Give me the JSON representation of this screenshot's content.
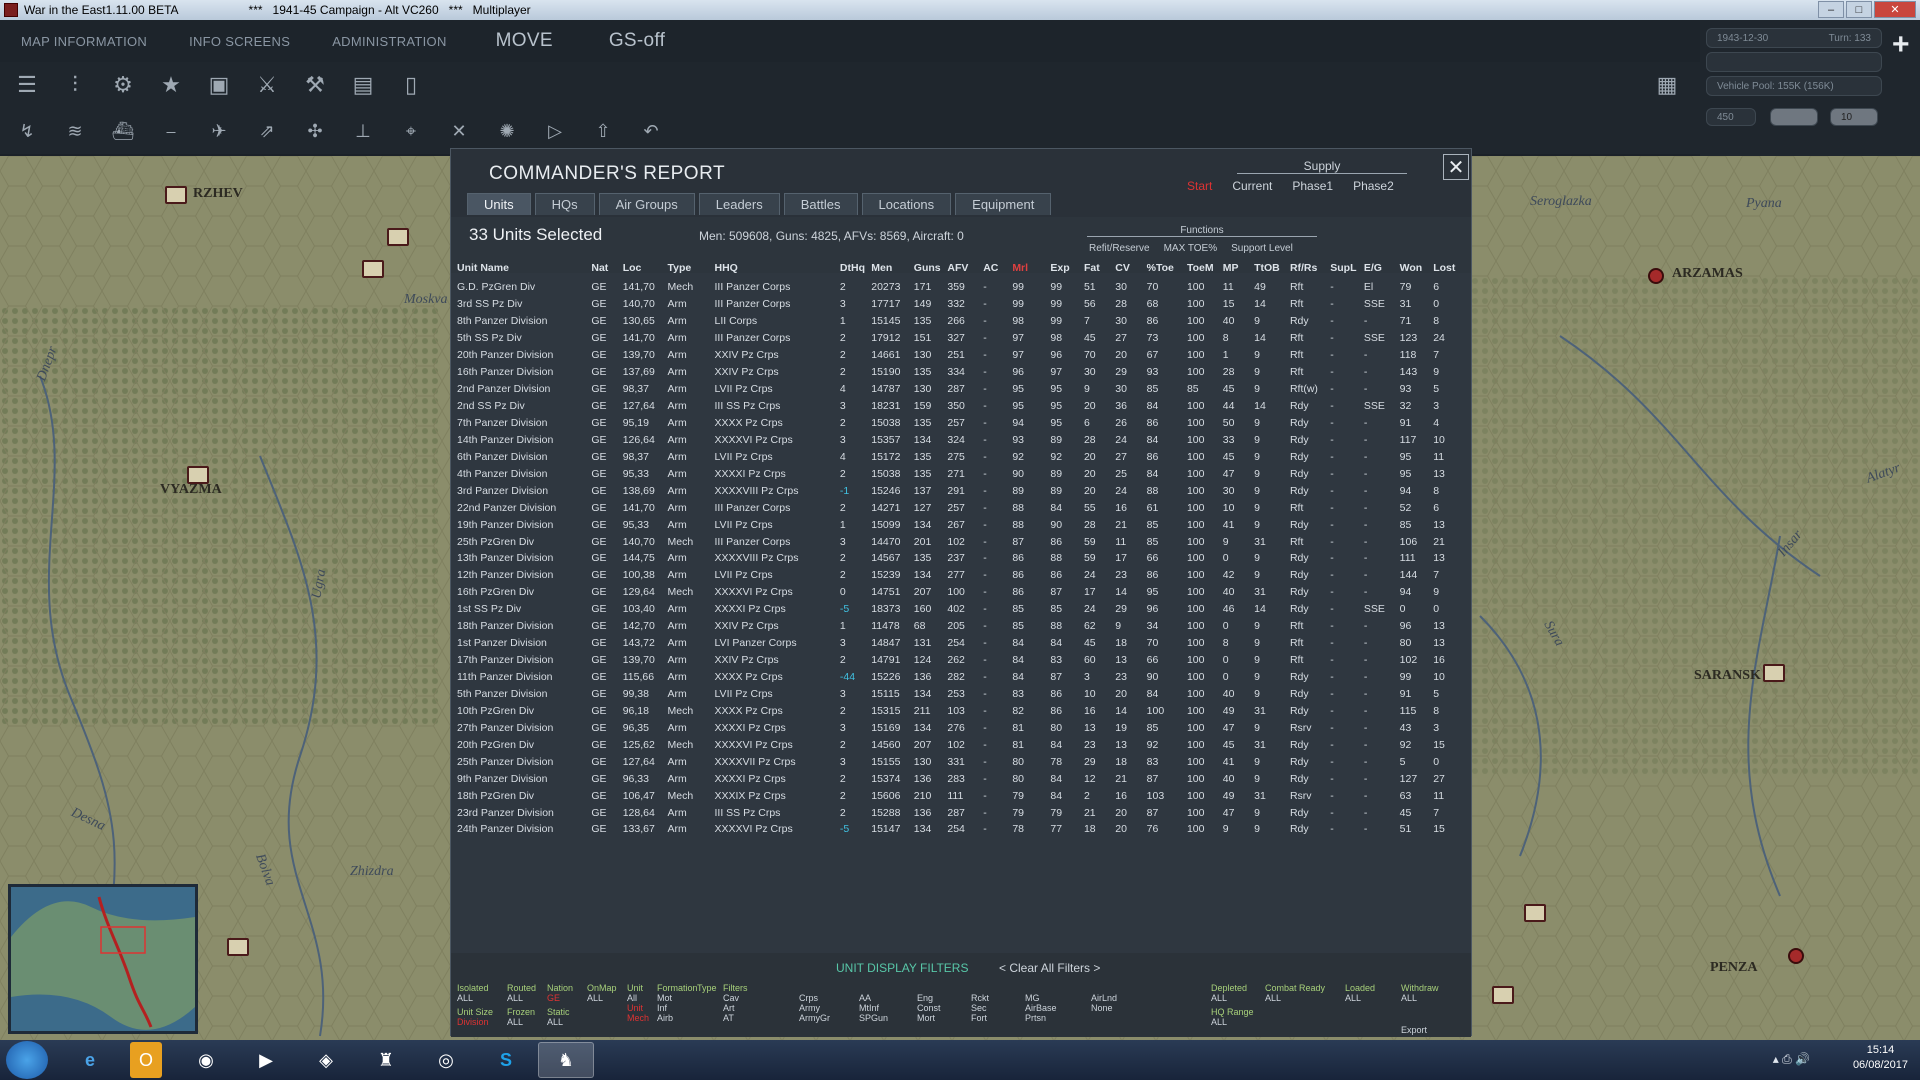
{
  "window": {
    "title": "War in the East1.11.00 BETA",
    "subtitle": "***   1941-45 Campaign - Alt VC260   ***   Multiplayer"
  },
  "topmenu": {
    "map_information": "MAP INFORMATION",
    "info_screens": "INFO SCREENS",
    "administration": "ADMINISTRATION",
    "move": "MOVE",
    "gs_off": "GS-off"
  },
  "right_info": {
    "date": "1943-12-30",
    "turn": "Turn: 133",
    "vehicle_pool": "Vehicle Pool: 155K (156K)",
    "value": "450",
    "counter": "10"
  },
  "map": {
    "cities": [
      "RZHEV",
      "VYAZMA",
      "ARZAMAS",
      "SARANSK",
      "PENZA"
    ],
    "rivers": [
      "Desna",
      "Ugra",
      "Zhizdra",
      "Bolva",
      "Moskva",
      "Dnepr",
      "Alatyr",
      "Pyana",
      "Sura",
      "Insar",
      "Seroglazka"
    ]
  },
  "dialog": {
    "title": "COMMANDER'S REPORT",
    "supply": {
      "label": "Supply",
      "options": [
        "Start",
        "Current",
        "Phase1",
        "Phase2"
      ]
    },
    "tabs": [
      "Units",
      "HQs",
      "Air Groups",
      "Leaders",
      "Battles",
      "Locations",
      "Equipment"
    ],
    "selected": "33 Units Selected",
    "stats": "Men: 509608, Guns: 4825, AFVs: 8569, Aircraft: 0",
    "functions": {
      "label": "Functions",
      "options": [
        "Refit/Reserve",
        "MAX TOE%",
        "Support Level"
      ]
    },
    "columns": [
      "Unit Name",
      "Nat",
      "Loc",
      "Type",
      "HHQ",
      "DtHq",
      "Men",
      "Guns",
      "AFV",
      "AC",
      "Mrl",
      "Exp",
      "Fat",
      "CV",
      "%Toe",
      "ToeM",
      "MP",
      "TtOB",
      "Rf/Rs",
      "SupL",
      "E/G",
      "Won",
      "Lost"
    ],
    "rows": [
      [
        "G.D. PzGren Div",
        "GE",
        "141,70",
        "Mech",
        "III Panzer Corps",
        "2",
        "20273",
        "171",
        "359",
        "-",
        "99",
        "99",
        "51",
        "30",
        "70",
        "100",
        "11",
        "49",
        "Rft",
        "-",
        "El",
        "79",
        "6"
      ],
      [
        "3rd SS Pz Div",
        "GE",
        "140,70",
        "Arm",
        "III Panzer Corps",
        "3",
        "17717",
        "149",
        "332",
        "-",
        "99",
        "99",
        "56",
        "28",
        "68",
        "100",
        "15",
        "14",
        "Rft",
        "-",
        "SSE",
        "31",
        "0"
      ],
      [
        "8th Panzer Division",
        "GE",
        "130,65",
        "Arm",
        "LII Corps",
        "1",
        "15145",
        "135",
        "266",
        "-",
        "98",
        "99",
        "7",
        "30",
        "86",
        "100",
        "40",
        "9",
        "Rdy",
        "-",
        "-",
        "71",
        "8"
      ],
      [
        "5th SS Pz Div",
        "GE",
        "141,70",
        "Arm",
        "III Panzer Corps",
        "2",
        "17912",
        "151",
        "327",
        "-",
        "97",
        "98",
        "45",
        "27",
        "73",
        "100",
        "8",
        "14",
        "Rft",
        "-",
        "SSE",
        "123",
        "24"
      ],
      [
        "20th Panzer Division",
        "GE",
        "139,70",
        "Arm",
        "XXIV Pz Crps",
        "2",
        "14661",
        "130",
        "251",
        "-",
        "97",
        "96",
        "70",
        "20",
        "67",
        "100",
        "1",
        "9",
        "Rft",
        "-",
        "-",
        "118",
        "7"
      ],
      [
        "16th Panzer Division",
        "GE",
        "137,69",
        "Arm",
        "XXIV Pz Crps",
        "2",
        "15190",
        "135",
        "334",
        "-",
        "96",
        "97",
        "30",
        "29",
        "93",
        "100",
        "28",
        "9",
        "Rft",
        "-",
        "-",
        "143",
        "9"
      ],
      [
        "2nd Panzer Division",
        "GE",
        "98,37",
        "Arm",
        "LVII Pz Crps",
        "4",
        "14787",
        "130",
        "287",
        "-",
        "95",
        "95",
        "9",
        "30",
        "85",
        "85",
        "45",
        "9",
        "Rft(w)",
        "-",
        "-",
        "93",
        "5"
      ],
      [
        "2nd SS Pz Div",
        "GE",
        "127,64",
        "Arm",
        "III SS Pz Crps",
        "3",
        "18231",
        "159",
        "350",
        "-",
        "95",
        "95",
        "20",
        "36",
        "84",
        "100",
        "44",
        "14",
        "Rdy",
        "-",
        "SSE",
        "32",
        "3"
      ],
      [
        "7th Panzer Division",
        "GE",
        "95,19",
        "Arm",
        "XXXX Pz Crps",
        "2",
        "15038",
        "135",
        "257",
        "-",
        "94",
        "95",
        "6",
        "26",
        "86",
        "100",
        "50",
        "9",
        "Rdy",
        "-",
        "-",
        "91",
        "4"
      ],
      [
        "14th Panzer Division",
        "GE",
        "126,64",
        "Arm",
        "XXXXVI Pz Crps",
        "3",
        "15357",
        "134",
        "324",
        "-",
        "93",
        "89",
        "28",
        "24",
        "84",
        "100",
        "33",
        "9",
        "Rdy",
        "-",
        "-",
        "117",
        "10"
      ],
      [
        "6th Panzer Division",
        "GE",
        "98,37",
        "Arm",
        "LVII Pz Crps",
        "4",
        "15172",
        "135",
        "275",
        "-",
        "92",
        "92",
        "20",
        "27",
        "86",
        "100",
        "45",
        "9",
        "Rdy",
        "-",
        "-",
        "95",
        "11"
      ],
      [
        "4th Panzer Division",
        "GE",
        "95,33",
        "Arm",
        "XXXXI Pz Crps",
        "2",
        "15038",
        "135",
        "271",
        "-",
        "90",
        "89",
        "20",
        "25",
        "84",
        "100",
        "47",
        "9",
        "Rdy",
        "-",
        "-",
        "95",
        "13"
      ],
      [
        "3rd Panzer Division",
        "GE",
        "138,69",
        "Arm",
        "XXXXVIII Pz Crps",
        "-1",
        "15246",
        "137",
        "291",
        "-",
        "89",
        "89",
        "20",
        "24",
        "88",
        "100",
        "30",
        "9",
        "Rdy",
        "-",
        "-",
        "94",
        "8"
      ],
      [
        "22nd Panzer Division",
        "GE",
        "141,70",
        "Arm",
        "III Panzer Corps",
        "2",
        "14271",
        "127",
        "257",
        "-",
        "88",
        "84",
        "55",
        "16",
        "61",
        "100",
        "10",
        "9",
        "Rft",
        "-",
        "-",
        "52",
        "6"
      ],
      [
        "19th Panzer Division",
        "GE",
        "95,33",
        "Arm",
        "LVII Pz Crps",
        "1",
        "15099",
        "134",
        "267",
        "-",
        "88",
        "90",
        "28",
        "21",
        "85",
        "100",
        "41",
        "9",
        "Rdy",
        "-",
        "-",
        "85",
        "13"
      ],
      [
        "25th PzGren Div",
        "GE",
        "140,70",
        "Mech",
        "III Panzer Corps",
        "3",
        "14470",
        "201",
        "102",
        "-",
        "87",
        "86",
        "59",
        "11",
        "85",
        "100",
        "9",
        "31",
        "Rft",
        "-",
        "-",
        "106",
        "21"
      ],
      [
        "13th Panzer Division",
        "GE",
        "144,75",
        "Arm",
        "XXXXVIII Pz Crps",
        "2",
        "14567",
        "135",
        "237",
        "-",
        "86",
        "88",
        "59",
        "17",
        "66",
        "100",
        "0",
        "9",
        "Rdy",
        "-",
        "-",
        "111",
        "13"
      ],
      [
        "12th Panzer Division",
        "GE",
        "100,38",
        "Arm",
        "LVII Pz Crps",
        "2",
        "15239",
        "134",
        "277",
        "-",
        "86",
        "86",
        "24",
        "23",
        "86",
        "100",
        "42",
        "9",
        "Rdy",
        "-",
        "-",
        "144",
        "7"
      ],
      [
        "16th PzGren Div",
        "GE",
        "129,64",
        "Mech",
        "XXXXVI Pz Crps",
        "0",
        "14751",
        "207",
        "100",
        "-",
        "86",
        "87",
        "17",
        "14",
        "95",
        "100",
        "40",
        "31",
        "Rdy",
        "-",
        "-",
        "94",
        "9"
      ],
      [
        "1st SS Pz Div",
        "GE",
        "103,40",
        "Arm",
        "XXXXI Pz Crps",
        "-5",
        "18373",
        "160",
        "402",
        "-",
        "85",
        "85",
        "24",
        "29",
        "96",
        "100",
        "46",
        "14",
        "Rdy",
        "-",
        "SSE",
        "0",
        "0"
      ],
      [
        "18th Panzer Division",
        "GE",
        "142,70",
        "Arm",
        "XXIV Pz Crps",
        "1",
        "11478",
        "68",
        "205",
        "-",
        "85",
        "88",
        "62",
        "9",
        "34",
        "100",
        "0",
        "9",
        "Rft",
        "-",
        "-",
        "96",
        "13"
      ],
      [
        "1st Panzer Division",
        "GE",
        "143,72",
        "Arm",
        "LVI Panzer Corps",
        "3",
        "14847",
        "131",
        "254",
        "-",
        "84",
        "84",
        "45",
        "18",
        "70",
        "100",
        "8",
        "9",
        "Rft",
        "-",
        "-",
        "80",
        "13"
      ],
      [
        "17th Panzer Division",
        "GE",
        "139,70",
        "Arm",
        "XXIV Pz Crps",
        "2",
        "14791",
        "124",
        "262",
        "-",
        "84",
        "83",
        "60",
        "13",
        "66",
        "100",
        "0",
        "9",
        "Rft",
        "-",
        "-",
        "102",
        "16"
      ],
      [
        "11th Panzer Division",
        "GE",
        "115,66",
        "Arm",
        "XXXX Pz Crps",
        "-44",
        "15226",
        "136",
        "282",
        "-",
        "84",
        "87",
        "3",
        "23",
        "90",
        "100",
        "0",
        "9",
        "Rdy",
        "-",
        "-",
        "99",
        "10"
      ],
      [
        "5th Panzer Division",
        "GE",
        "99,38",
        "Arm",
        "LVII Pz Crps",
        "3",
        "15115",
        "134",
        "253",
        "-",
        "83",
        "86",
        "10",
        "20",
        "84",
        "100",
        "40",
        "9",
        "Rdy",
        "-",
        "-",
        "91",
        "5"
      ],
      [
        "10th PzGren Div",
        "GE",
        "96,18",
        "Mech",
        "XXXX Pz Crps",
        "2",
        "15315",
        "211",
        "103",
        "-",
        "82",
        "86",
        "16",
        "14",
        "100",
        "100",
        "49",
        "31",
        "Rdy",
        "-",
        "-",
        "115",
        "8"
      ],
      [
        "27th Panzer Division",
        "GE",
        "96,35",
        "Arm",
        "XXXXI Pz Crps",
        "3",
        "15169",
        "134",
        "276",
        "-",
        "81",
        "80",
        "13",
        "19",
        "85",
        "100",
        "47",
        "9",
        "Rsrv",
        "-",
        "-",
        "43",
        "3"
      ],
      [
        "20th PzGren Div",
        "GE",
        "125,62",
        "Mech",
        "XXXXVI Pz Crps",
        "2",
        "14560",
        "207",
        "102",
        "-",
        "81",
        "84",
        "23",
        "13",
        "92",
        "100",
        "45",
        "31",
        "Rdy",
        "-",
        "-",
        "92",
        "15"
      ],
      [
        "25th Panzer Division",
        "GE",
        "127,64",
        "Arm",
        "XXXXVII Pz Crps",
        "3",
        "15155",
        "130",
        "331",
        "-",
        "80",
        "78",
        "29",
        "18",
        "83",
        "100",
        "41",
        "9",
        "Rdy",
        "-",
        "-",
        "5",
        "0"
      ],
      [
        "9th Panzer Division",
        "GE",
        "96,33",
        "Arm",
        "XXXXI Pz Crps",
        "2",
        "15374",
        "136",
        "283",
        "-",
        "80",
        "84",
        "12",
        "21",
        "87",
        "100",
        "40",
        "9",
        "Rdy",
        "-",
        "-",
        "127",
        "27"
      ],
      [
        "18th PzGren Div",
        "GE",
        "106,47",
        "Mech",
        "XXXIX Pz Crps",
        "2",
        "15606",
        "210",
        "111",
        "-",
        "79",
        "84",
        "2",
        "16",
        "103",
        "100",
        "49",
        "31",
        "Rsrv",
        "-",
        "-",
        "63",
        "11"
      ],
      [
        "23rd Panzer Division",
        "GE",
        "128,64",
        "Arm",
        "III SS Pz Crps",
        "2",
        "15288",
        "136",
        "287",
        "-",
        "79",
        "79",
        "21",
        "20",
        "87",
        "100",
        "47",
        "9",
        "Rdy",
        "-",
        "-",
        "45",
        "7"
      ],
      [
        "24th Panzer Division",
        "GE",
        "133,67",
        "Arm",
        "XXXXVI Pz Crps",
        "-5",
        "15147",
        "134",
        "254",
        "-",
        "78",
        "77",
        "18",
        "20",
        "76",
        "100",
        "9",
        "9",
        "Rdy",
        "-",
        "-",
        "51",
        "15"
      ]
    ],
    "filters": {
      "title": "UNIT DISPLAY FILTERS",
      "clear": "< Clear All Filters >",
      "groups": [
        {
          "label": "Isolated",
          "values": [
            "ALL"
          ]
        },
        {
          "label": "Routed",
          "values": [
            "ALL"
          ]
        },
        {
          "label": "Nation",
          "values": [
            "GE"
          ],
          "red": true
        },
        {
          "label": "OnMap",
          "values": [
            "ALL"
          ]
        },
        {
          "label": "Unit",
          "values": [
            "All",
            "Unit",
            "Mech"
          ],
          "red_from": 1
        },
        {
          "label": "Formation",
          "values": [
            "Mot",
            "Inf",
            "Airb"
          ]
        },
        {
          "label": "Type",
          "values": []
        },
        {
          "label": "Filters",
          "values": [
            "Cav",
            "Art",
            "AT"
          ]
        },
        {
          "label": "",
          "values": [
            "Crps",
            "Army",
            "ArmyGr"
          ]
        },
        {
          "label": "",
          "values": [
            "AA",
            "MtInf",
            "SPGun"
          ]
        },
        {
          "label": "",
          "values": [
            "Eng",
            "Const",
            "Mort"
          ]
        },
        {
          "label": "",
          "values": [
            "Rckt",
            "Sec",
            "Fort"
          ]
        },
        {
          "label": "",
          "values": [
            "MG",
            "AirBase",
            "Prtsn"
          ]
        },
        {
          "label": "",
          "values": [
            "AirLnd",
            "None"
          ]
        },
        {
          "label": "Depleted",
          "values": [
            "ALL"
          ]
        },
        {
          "label": "Combat Ready",
          "values": [
            "ALL"
          ]
        },
        {
          "label": "Loaded",
          "values": [
            "ALL"
          ]
        },
        {
          "label": "Withdraw",
          "values": [
            "ALL"
          ]
        },
        {
          "label": "Unit Size",
          "values": [
            "Division"
          ],
          "red": true
        },
        {
          "label": "Frozen",
          "values": [
            "ALL"
          ]
        },
        {
          "label": "Static",
          "values": [
            "ALL"
          ]
        },
        {
          "label": "HQ Range",
          "values": [
            "ALL"
          ]
        }
      ],
      "export": "Export"
    }
  },
  "taskbar": {
    "time": "15:14",
    "date": "06/08/2017"
  }
}
